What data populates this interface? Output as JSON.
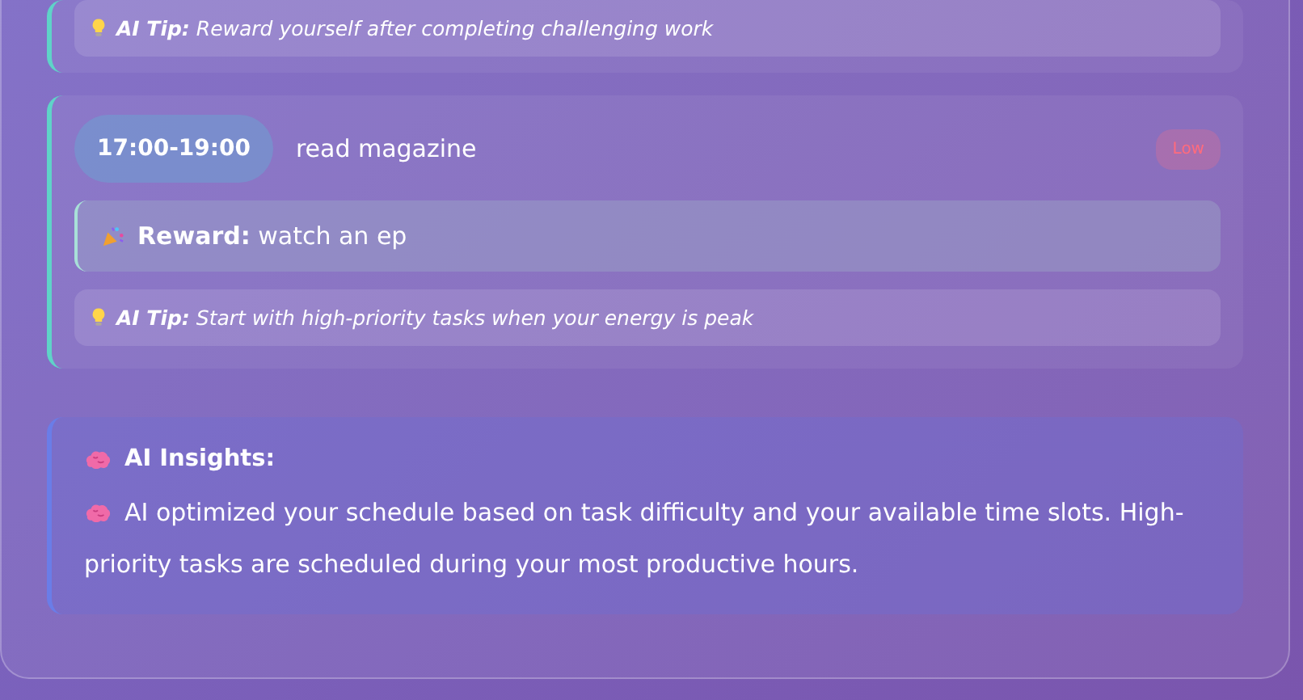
{
  "tasks": [
    {
      "tip": "**AI Tip:** Reward yourself after completing challenging work"
    },
    {
      "time": "17:00-19:00",
      "title": "read magazine",
      "priority": {
        "label": "Low",
        "kind": "low"
      },
      "reward": "**Reward:** watch an ep",
      "tip": "**AI Tip:** Start with high-priority tasks when your energy is peak"
    }
  ],
  "insights": {
    "title": "AI Insights:",
    "text": "AI optimized your schedule based on task difficulty and your available time slots. High-priority tasks are scheduled during your most productive hours."
  }
}
